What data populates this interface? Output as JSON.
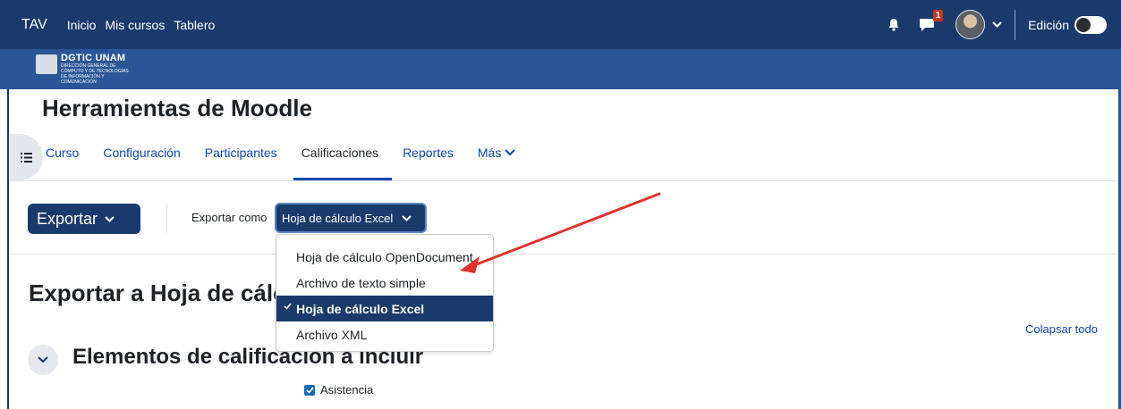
{
  "navbar": {
    "brand": "TAV",
    "links": [
      "Inicio",
      "Mis cursos",
      "Tablero"
    ],
    "notifications_count": "1",
    "edit_label": "Edición"
  },
  "banner": {
    "logo_title": "DGTIC UNAM",
    "logo_subtitle": "DIRECCIÓN GENERAL DE CÓMPUTO Y DE TECNOLOGÍAS DE INFORMACIÓN Y COMUNICACIÓN"
  },
  "course": {
    "title": "Herramientas de Moodle"
  },
  "tabs": [
    {
      "label": "Curso"
    },
    {
      "label": "Configuración"
    },
    {
      "label": "Participantes"
    },
    {
      "label": "Calificaciones"
    },
    {
      "label": "Reportes"
    },
    {
      "label": "Más"
    }
  ],
  "toolbar": {
    "export_button": "Exportar",
    "export_as_label": "Exportar como",
    "selected_format": "Hoja de cálculo Excel"
  },
  "dropdown": {
    "options": [
      {
        "label": "Hoja de cálculo OpenDocument"
      },
      {
        "label": "Archivo de texto simple"
      },
      {
        "label": "Hoja de cálculo Excel"
      },
      {
        "label": "Archivo XML"
      }
    ],
    "selected_index": 2
  },
  "main": {
    "section_title": "Exportar a Hoja de cálculo Excel",
    "collapse_all": "Colapsar todo",
    "accordion_title": "Elementos de calificación a incluir",
    "checkbox_label": "Asistencia"
  },
  "colors": {
    "navbar": "#1b3a6c",
    "banner": "#2a5596",
    "link": "#0f47ad",
    "annotation_arrow": "#e0322e"
  },
  "icons": {
    "drawer": "list-icon",
    "bell": "bell-icon",
    "messages": "chat-icon",
    "accordion": "chevron-down-icon"
  }
}
